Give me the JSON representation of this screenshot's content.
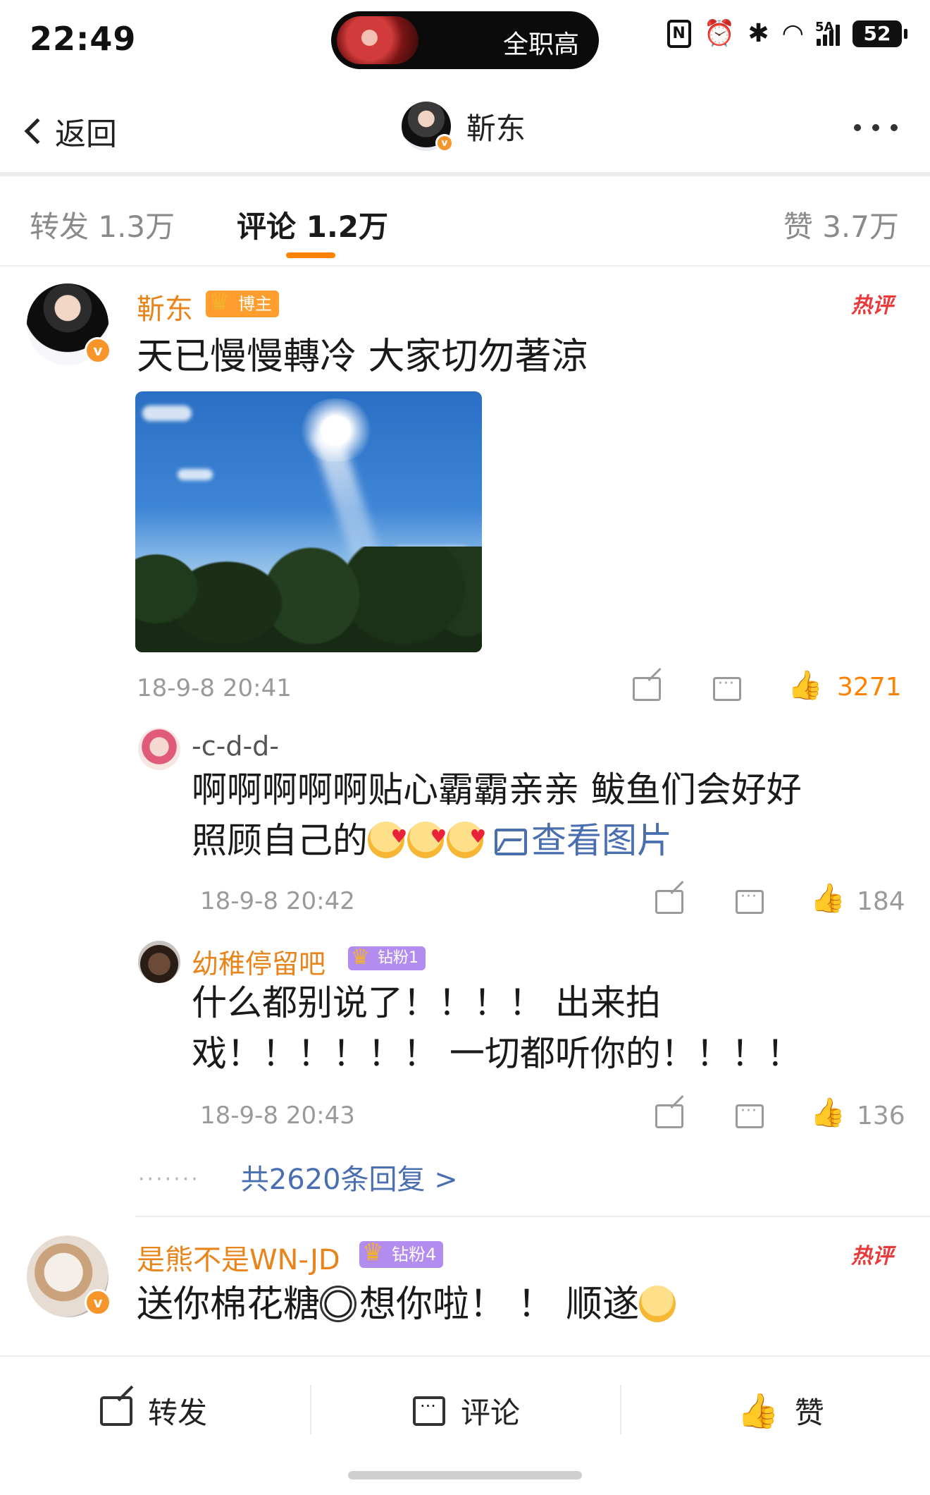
{
  "status_bar": {
    "time": "22:49",
    "island_text": "全职高",
    "signal_label": "5A",
    "battery": "52"
  },
  "header": {
    "back_label": "返回",
    "title": "靳东"
  },
  "tabs": {
    "repost": "转发 1.3万",
    "comment": "评论 1.2万",
    "like": "赞 3.7万"
  },
  "comments": [
    {
      "name": "靳东",
      "badge": "博主",
      "hot": "热评",
      "text": "天已慢慢轉冷  大家切勿著涼",
      "time": "18-9-8 20:41",
      "likes": "3271",
      "replies": [
        {
          "name": "-c-d-d-",
          "text_line1": "啊啊啊啊啊贴心霸霸亲亲 鲅鱼们会好好",
          "text_line2": "照顾自己的",
          "view_image": "查看图片",
          "time": "18-9-8 20:42",
          "likes": "184"
        },
        {
          "name": "幼稚停留吧",
          "badge": "钻粉1",
          "text_line1": "什么都别说了！！！！  出来拍",
          "text_line2": "戏！！！！！！  一切都听你的！！！！",
          "time": "18-9-8 20:43",
          "likes": "136"
        }
      ],
      "more_replies": "共2620条回复 >"
    },
    {
      "name": "是熊不是WN-JD",
      "badge": "钻粉4",
      "hot": "热评",
      "text_a": "送你棉花糖",
      "text_b": "想你啦！ ！ 顺遂"
    }
  ],
  "bottom_bar": {
    "repost": "转发",
    "comment": "评论",
    "like": "赞"
  },
  "colors": {
    "accent": "#ff8200",
    "name_orange": "#e8841a",
    "link_blue": "#4a6fb0",
    "hot_red": "#e83a3a"
  }
}
